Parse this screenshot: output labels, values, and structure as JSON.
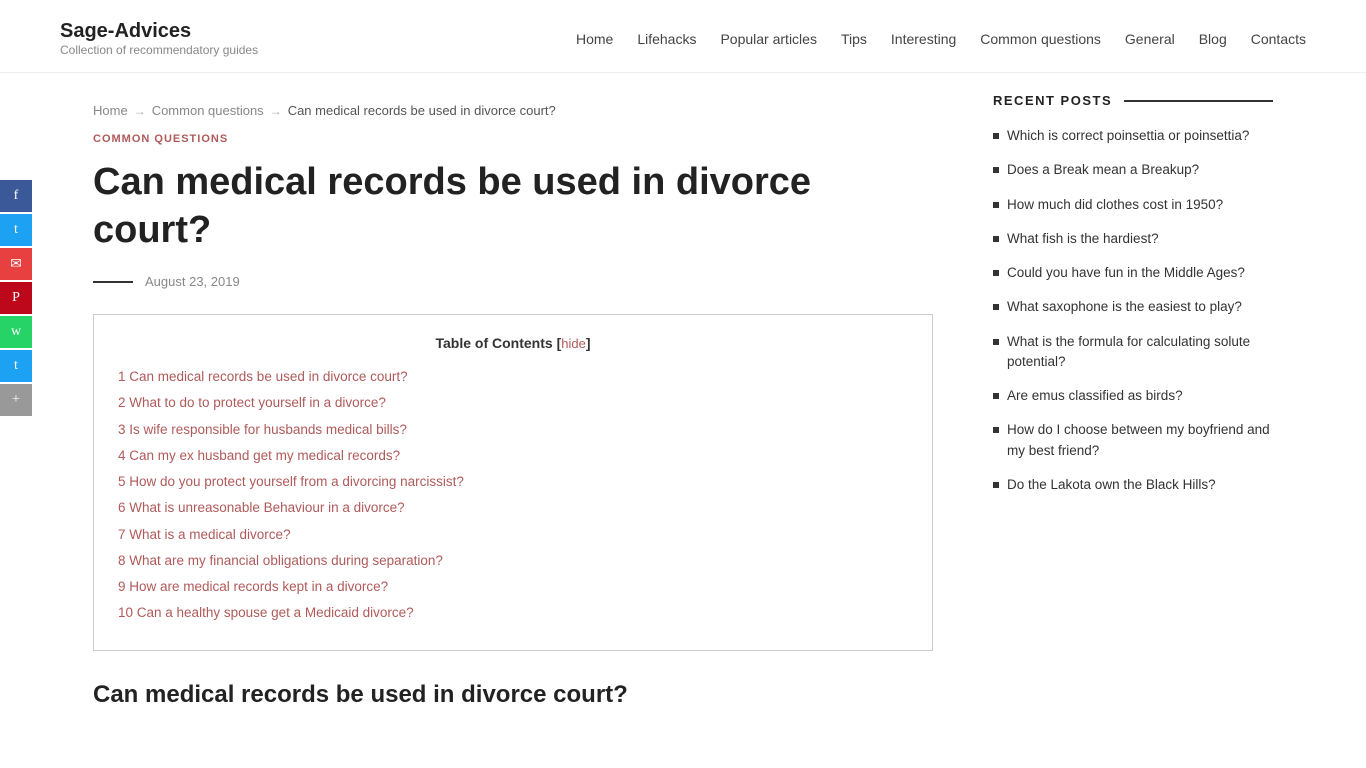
{
  "site": {
    "title": "Sage-Advices",
    "tagline": "Collection of recommendatory guides"
  },
  "nav": {
    "items": [
      {
        "label": "Home",
        "href": "#"
      },
      {
        "label": "Lifehacks",
        "href": "#"
      },
      {
        "label": "Popular articles",
        "href": "#"
      },
      {
        "label": "Tips",
        "href": "#"
      },
      {
        "label": "Interesting",
        "href": "#"
      },
      {
        "label": "Common questions",
        "href": "#"
      },
      {
        "label": "General",
        "href": "#"
      },
      {
        "label": "Blog",
        "href": "#"
      },
      {
        "label": "Contacts",
        "href": "#"
      }
    ]
  },
  "breadcrumb": {
    "home": "Home",
    "section": "Common questions",
    "current": "Can medical records be used in divorce court?"
  },
  "article": {
    "category": "COMMON QUESTIONS",
    "title": "Can medical records be used in divorce court?",
    "date": "August 23, 2019",
    "toc_label": "Table of Contents",
    "toc_hide": "hide",
    "toc_items": [
      {
        "num": "1",
        "text": "Can medical records be used in divorce court?"
      },
      {
        "num": "2",
        "text": "What to do to protect yourself in a divorce?"
      },
      {
        "num": "3",
        "text": "Is wife responsible for husbands medical bills?"
      },
      {
        "num": "4",
        "text": "Can my ex husband get my medical records?"
      },
      {
        "num": "5",
        "text": "How do you protect yourself from a divorcing narcissist?"
      },
      {
        "num": "6",
        "text": "What is unreasonable Behaviour in a divorce?"
      },
      {
        "num": "7",
        "text": "What is a medical divorce?"
      },
      {
        "num": "8",
        "text": "What are my financial obligations during separation?"
      },
      {
        "num": "9",
        "text": "How are medical records kept in a divorce?"
      },
      {
        "num": "10",
        "text": "Can a healthy spouse get a Medicaid divorce?"
      }
    ],
    "section_heading": "Can medical records be used in divorce court?"
  },
  "sidebar": {
    "recent_posts_label": "RECENT POSTS",
    "posts": [
      {
        "text": "Which is correct poinsettia or poinsettia?"
      },
      {
        "text": "Does a Break mean a Breakup?"
      },
      {
        "text": "How much did clothes cost in 1950?"
      },
      {
        "text": "What fish is the hardiest?"
      },
      {
        "text": "Could you have fun in the Middle Ages?"
      },
      {
        "text": "What saxophone is the easiest to play?"
      },
      {
        "text": "What is the formula for calculating solute potential?"
      },
      {
        "text": "Are emus classified as birds?"
      },
      {
        "text": "How do I choose between my boyfriend and my best friend?"
      },
      {
        "text": "Do the Lakota own the Black Hills?"
      }
    ]
  },
  "social": [
    {
      "icon": "f",
      "class": "fb",
      "name": "facebook"
    },
    {
      "icon": "t",
      "class": "tw",
      "name": "twitter"
    },
    {
      "icon": "✉",
      "class": "em",
      "name": "email"
    },
    {
      "icon": "P",
      "class": "pi",
      "name": "pinterest"
    },
    {
      "icon": "w",
      "class": "wa",
      "name": "whatsapp"
    },
    {
      "icon": "t",
      "class": "tw2",
      "name": "twitter2"
    },
    {
      "icon": "+",
      "class": "sh",
      "name": "share"
    }
  ]
}
